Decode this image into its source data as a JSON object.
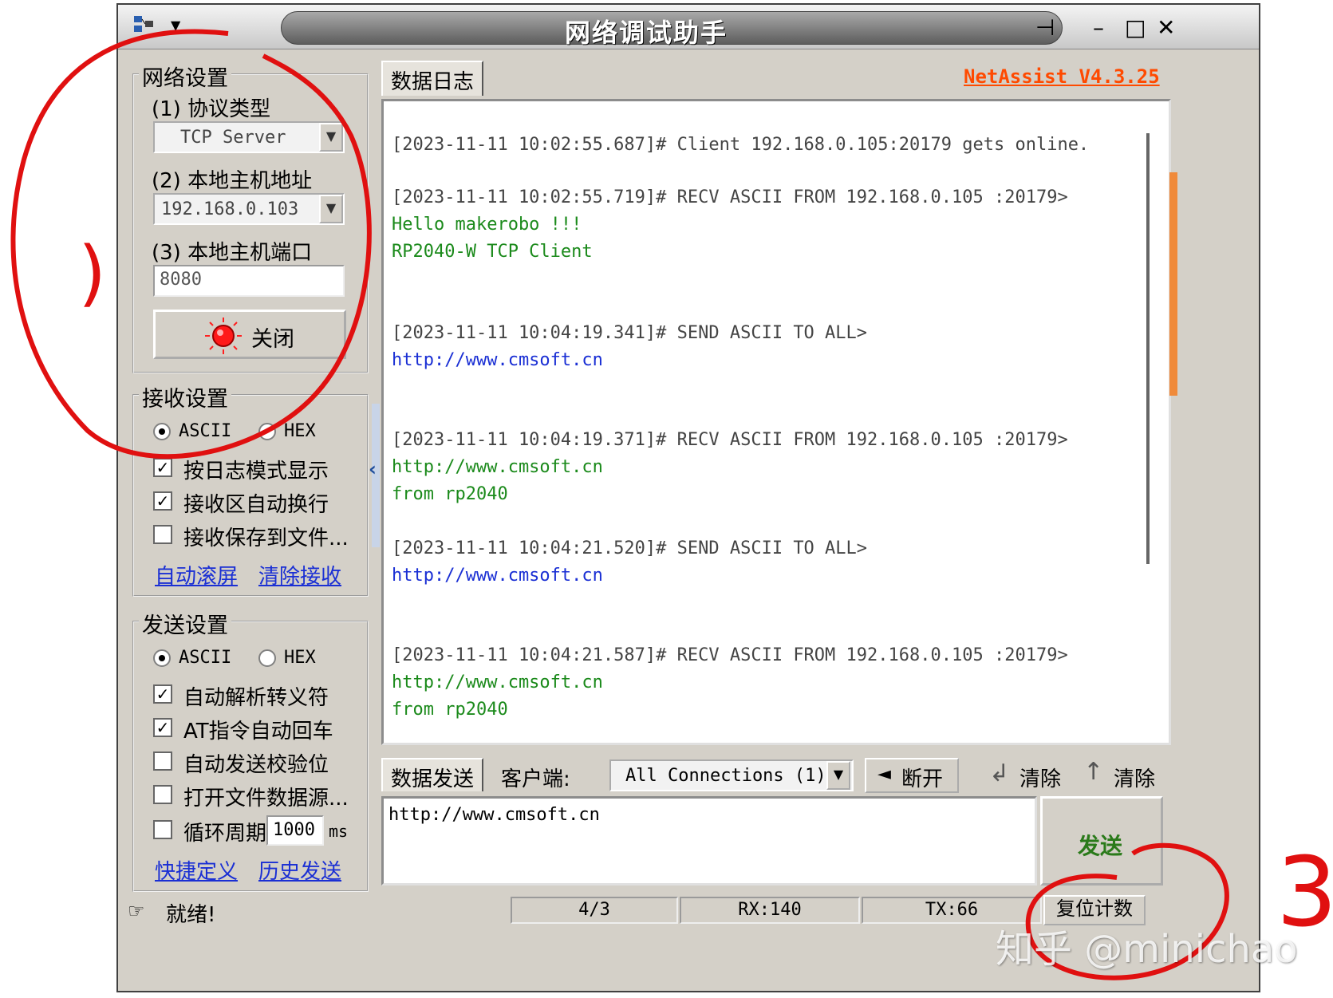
{
  "window": {
    "title": "网络调试助手",
    "version_label": "NetAssist V4.3.25"
  },
  "network_settings": {
    "title": "网络设置",
    "protocol_label": "(1) 协议类型",
    "protocol_value": "TCP Server",
    "local_addr_label": "(2) 本地主机地址",
    "local_addr_value": "192.168.0.103",
    "local_port_label": "(3) 本地主机端口",
    "local_port_value": "8080",
    "close_button": "关闭"
  },
  "receive_settings": {
    "title": "接收设置",
    "ascii": "ASCII",
    "hex": "HEX",
    "opt_log_mode": "按日志模式显示",
    "opt_auto_wrap": "接收区自动换行",
    "opt_save_file": "接收保存到文件...",
    "link_autoscroll": "自动滚屏",
    "link_clear": "清除接收"
  },
  "send_settings": {
    "title": "发送设置",
    "ascii": "ASCII",
    "hex": "HEX",
    "opt_escape": "自动解析转义符",
    "opt_at_cr": "AT指令自动回车",
    "opt_checksum": "自动发送校验位",
    "opt_file_source": "打开文件数据源...",
    "opt_loop": "循环周期",
    "loop_value": "1000",
    "loop_unit": "ms",
    "link_shortcut": "快捷定义",
    "link_history": "历史发送"
  },
  "log": {
    "tab": "数据日志",
    "lines": [
      {
        "text": "[2023-11-11 10:02:55.687]# Client 192.168.0.105:20179 gets online.",
        "color": "#444444"
      },
      {
        "text": "[2023-11-11 10:02:55.719]# RECV ASCII FROM 192.168.0.105 :20179>",
        "color": "#444444"
      },
      {
        "text": "Hello makerobo !!!",
        "color": "#1b8a1b"
      },
      {
        "text": "RP2040-W TCP Client",
        "color": "#1b8a1b"
      },
      {
        "text": "[2023-11-11 10:04:19.341]# SEND ASCII TO ALL>",
        "color": "#444444"
      },
      {
        "text": "http://www.cmsoft.cn",
        "color": "#1a2fd4"
      },
      {
        "text": "[2023-11-11 10:04:19.371]# RECV ASCII FROM 192.168.0.105 :20179>",
        "color": "#444444"
      },
      {
        "text": "http://www.cmsoft.cn",
        "color": "#1b8a1b"
      },
      {
        "text": "from rp2040",
        "color": "#1b8a1b"
      },
      {
        "text": "[2023-11-11 10:04:21.520]# SEND ASCII TO ALL>",
        "color": "#444444"
      },
      {
        "text": "http://www.cmsoft.cn",
        "color": "#1a2fd4"
      },
      {
        "text": "[2023-11-11 10:04:21.587]# RECV ASCII FROM 192.168.0.105 :20179>",
        "color": "#444444"
      },
      {
        "text": "http://www.cmsoft.cn",
        "color": "#1b8a1b"
      },
      {
        "text": "from rp2040",
        "color": "#1b8a1b"
      }
    ]
  },
  "send_bar": {
    "tab": "数据发送",
    "client_label": "客户端:",
    "client_value": "All Connections (1)",
    "disconnect": "断开",
    "clear1": "清除",
    "clear2": "清除",
    "send_text": "http://www.cmsoft.cn",
    "send_button": "发送"
  },
  "status": {
    "ready": "就绪!",
    "count": "4/3",
    "rx": "RX:140",
    "tx": "TX:66",
    "reset": "复位计数"
  },
  "annotations": {
    "label_1": ")",
    "label_3": "3",
    "watermark": "知乎 @minichao"
  },
  "colors": {
    "accent_red": "#e01010",
    "link_blue": "#1a2fd4",
    "recv_green": "#1b8a1b",
    "send_green": "#2a7a1a"
  }
}
